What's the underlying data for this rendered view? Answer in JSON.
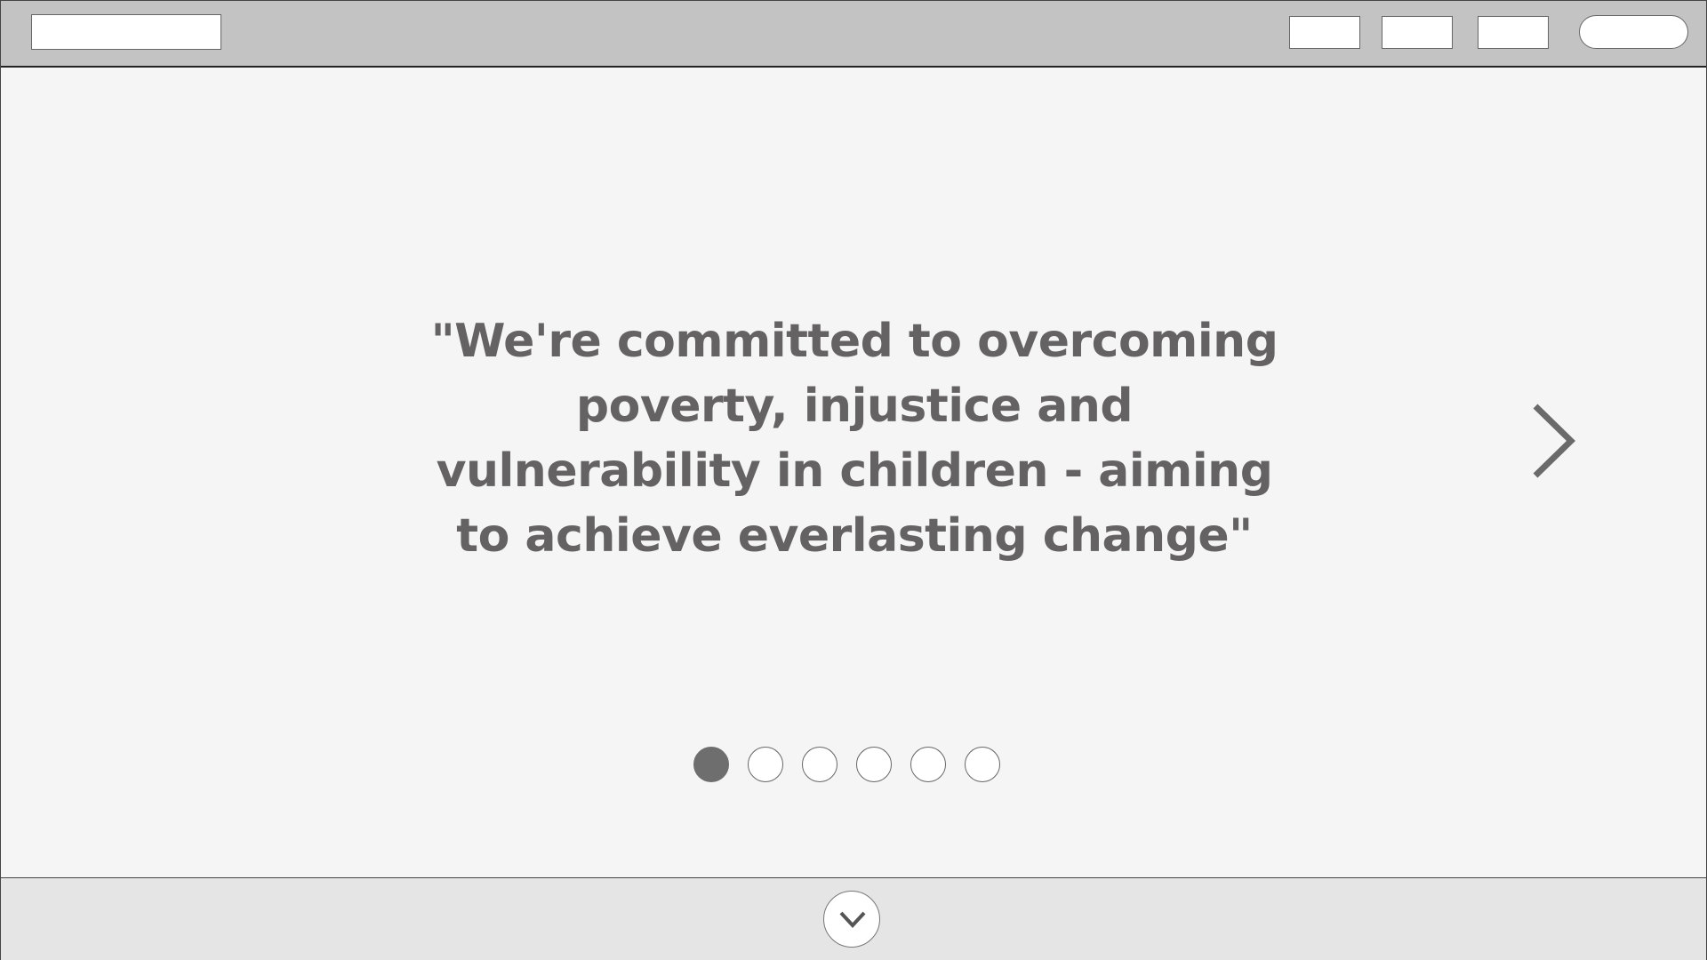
{
  "hero": {
    "quote": "\"We're committed to overcoming poverty, injustice and vulnerability in children - aiming to achieve everlasting change\""
  },
  "carousel": {
    "slide_count": 6,
    "active_index": 0,
    "next_icon": "chevron-right-icon"
  },
  "footer": {
    "scroll_icon": "chevron-down-icon"
  },
  "colors": {
    "header_bg": "#c3c3c3",
    "page_bg": "#f5f5f5",
    "footer_bg": "#e5e5e5",
    "text": "#646262",
    "active_dot": "#6e6e6e"
  }
}
